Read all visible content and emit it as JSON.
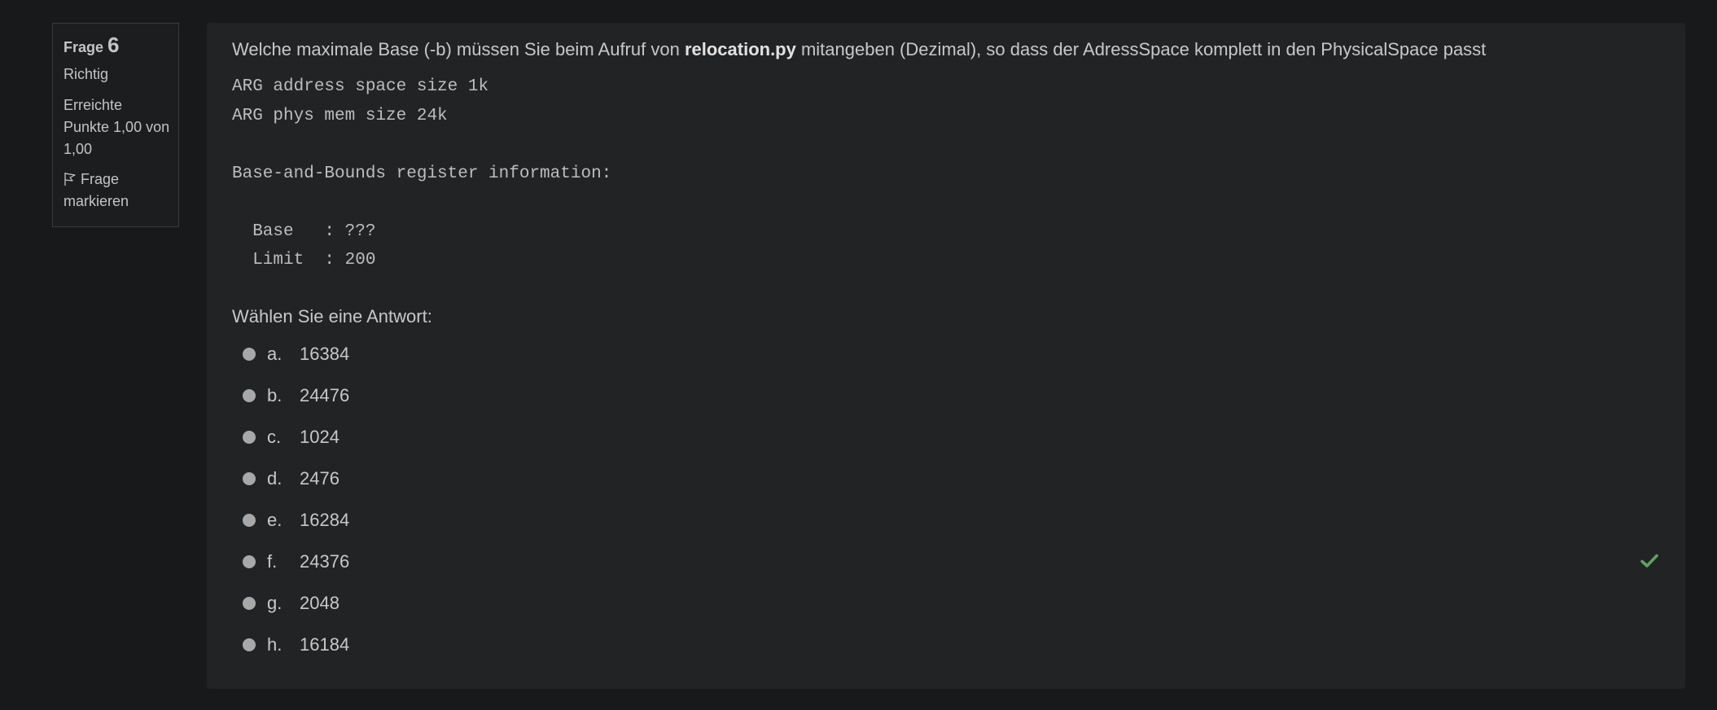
{
  "question_info": {
    "label": "Frage",
    "number": "6",
    "state": "Richtig",
    "grade_line1": "Erreichte",
    "grade_line2": "Punkte 1,00 von",
    "grade_line3": "1,00",
    "flag_line1": "Frage",
    "flag_line2": "markieren"
  },
  "question": {
    "text_before": "Welche maximale Base (-b) müssen Sie beim Aufruf von ",
    "text_bold": "relocation.py",
    "text_after": " mitangeben (Dezimal), so dass der AdressSpace komplett in den PhysicalSpace passt",
    "code": "ARG address space size 1k\nARG phys mem size 24k\n\nBase-and-Bounds register information:\n\n  Base   : ???\n  Limit  : 200",
    "prompt": "Wählen Sie eine Antwort:"
  },
  "answers": [
    {
      "letter": "a.",
      "value": "16384",
      "correct": false
    },
    {
      "letter": "b.",
      "value": "24476",
      "correct": false
    },
    {
      "letter": "c.",
      "value": "1024",
      "correct": false
    },
    {
      "letter": "d.",
      "value": "2476",
      "correct": false
    },
    {
      "letter": "e.",
      "value": "16284",
      "correct": false
    },
    {
      "letter": "f.",
      "value": "24376",
      "correct": true
    },
    {
      "letter": "g.",
      "value": "2048",
      "correct": false
    },
    {
      "letter": "h.",
      "value": "16184",
      "correct": false
    }
  ],
  "colors": {
    "page_background": "#18191b",
    "panel_background": "#222325",
    "correct_check": "#5aa55a",
    "radio": "#a8a8a8"
  },
  "icons": {
    "flag": "flag-icon",
    "correct": "check-icon"
  }
}
